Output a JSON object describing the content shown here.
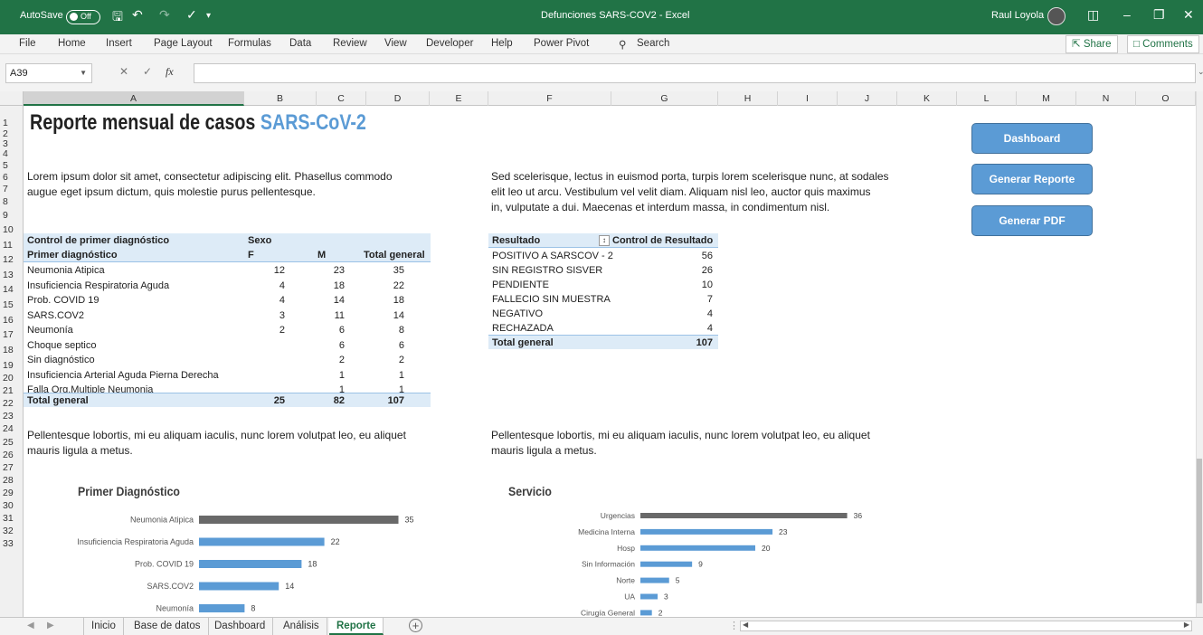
{
  "titlebar": {
    "autosave": "AutoSave",
    "toggle": "Off",
    "title": "Defunciones SARS-COV2  -  Excel",
    "user": "Raul Loyola"
  },
  "menu": [
    "File",
    "Home",
    "Insert",
    "Page Layout",
    "Formulas",
    "Data",
    "Review",
    "View",
    "Developer",
    "Help",
    "Power Pivot"
  ],
  "search": "Search",
  "share": "Share",
  "comments": "Comments",
  "namebox": "A39",
  "fx": "fx",
  "columns": [
    "A",
    "B",
    "C",
    "D",
    "E",
    "F",
    "G",
    "H",
    "I",
    "J",
    "K",
    "L",
    "M",
    "N",
    "O"
  ],
  "rows": [
    "1",
    "2",
    "3",
    "4",
    "5",
    "6",
    "7",
    "8",
    "9",
    "10",
    "11",
    "12",
    "13",
    "14",
    "15",
    "16",
    "17",
    "18",
    "19",
    "20",
    "21",
    "22",
    "23",
    "24",
    "25",
    "26",
    "27",
    "28",
    "29",
    "30",
    "31",
    "32",
    "33"
  ],
  "report": {
    "title_main": "Reporte mensual de casos",
    "title_accent": "SARS-CoV-2",
    "p1a": "Lorem ipsum dolor sit amet, consectetur adipiscing elit. Phasellus commodo",
    "p1b": "augue eget ipsum dictum, quis molestie purus pellentesque.",
    "p2a": "Sed scelerisque, lectus in euismod porta, turpis lorem scelerisque nunc, at sodales",
    "p2b": "elit leo ut arcu. Vestibulum vel velit diam. Aliquam nisl leo, auctor quis maximus",
    "p2c": "in, vulputate a dui. Maecenas et interdum massa, in condimentum nisl.",
    "p3a": "Pellentesque lobortis, mi eu aliquam iaculis, nunc lorem volutpat leo, eu aliquet",
    "p3b": "mauris ligula a metus.",
    "p4a": "Pellentesque lobortis, mi eu aliquam iaculis, nunc lorem volutpat leo, eu aliquet",
    "p4b": "mauris ligula a metus."
  },
  "pivot1": {
    "h1": "Control de primer diagnóstico",
    "h1b": "Sexo",
    "h2": "Primer diagnóstico",
    "h2b": "F",
    "h2c": "M",
    "h2d": "Total general",
    "rows": [
      {
        "label": "Neumonia Atipica",
        "f": "12",
        "m": "23",
        "t": "35"
      },
      {
        "label": "Insuficiencia Respiratoria Aguda",
        "f": "4",
        "m": "18",
        "t": "22"
      },
      {
        "label": "Prob. COVID 19",
        "f": "4",
        "m": "14",
        "t": "18"
      },
      {
        "label": "SARS.COV2",
        "f": "3",
        "m": "11",
        "t": "14"
      },
      {
        "label": "Neumonía",
        "f": "2",
        "m": "6",
        "t": "8"
      },
      {
        "label": "Choque septico",
        "f": "",
        "m": "6",
        "t": "6"
      },
      {
        "label": "Sin diagnóstico",
        "f": "",
        "m": "2",
        "t": "2"
      },
      {
        "label": "Insuficiencia Arterial Aguda Pierna Derecha",
        "f": "",
        "m": "1",
        "t": "1"
      },
      {
        "label": "Falla Org.Multiple Neumonia",
        "f": "",
        "m": "1",
        "t": "1"
      }
    ],
    "total": {
      "label": "Total general",
      "f": "25",
      "m": "82",
      "t": "107"
    }
  },
  "pivot2": {
    "h1": "Resultado",
    "h1b": "Control de Resultado",
    "rows": [
      {
        "label": "POSITIVO  A SARSCOV - 2",
        "v": "56"
      },
      {
        "label": "SIN REGISTRO SISVER",
        "v": "26"
      },
      {
        "label": "PENDIENTE",
        "v": "10"
      },
      {
        "label": "FALLECIO SIN MUESTRA",
        "v": "7"
      },
      {
        "label": "NEGATIVO",
        "v": "4"
      },
      {
        "label": "RECHAZADA",
        "v": "4"
      }
    ],
    "total": {
      "label": "Total general",
      "v": "107"
    }
  },
  "buttons": {
    "dashboard": "Dashboard",
    "report": "Generar Reporte",
    "pdf": "Generar PDF"
  },
  "chart_data": [
    {
      "type": "bar",
      "title": "Primer Diagnóstico",
      "categories": [
        "Neumonia Atipica",
        "Insuficiencia Respiratoria Aguda",
        "Prob. COVID 19",
        "SARS.COV2",
        "Neumonía"
      ],
      "values": [
        35,
        22,
        18,
        14,
        8
      ],
      "highlight": "#696969",
      "color": "#5b9bd5"
    },
    {
      "type": "bar",
      "title": "Servicio",
      "categories": [
        "Urgencias",
        "Medicina Interna",
        "Hosp",
        "Sin Información",
        "Norte",
        "UA",
        "Cirugía General"
      ],
      "values": [
        36,
        23,
        20,
        9,
        5,
        3,
        2
      ],
      "highlight": "#696969",
      "color": "#5b9bd5"
    }
  ],
  "tabs": [
    "Inicio",
    "Base de datos",
    "Dashboard",
    "Análisis",
    "Reporte"
  ],
  "active_tab": "Reporte",
  "colors": {
    "excel_green": "#217346",
    "accent_blue": "#5b9bd5",
    "pivot_header": "#ddebf7"
  }
}
